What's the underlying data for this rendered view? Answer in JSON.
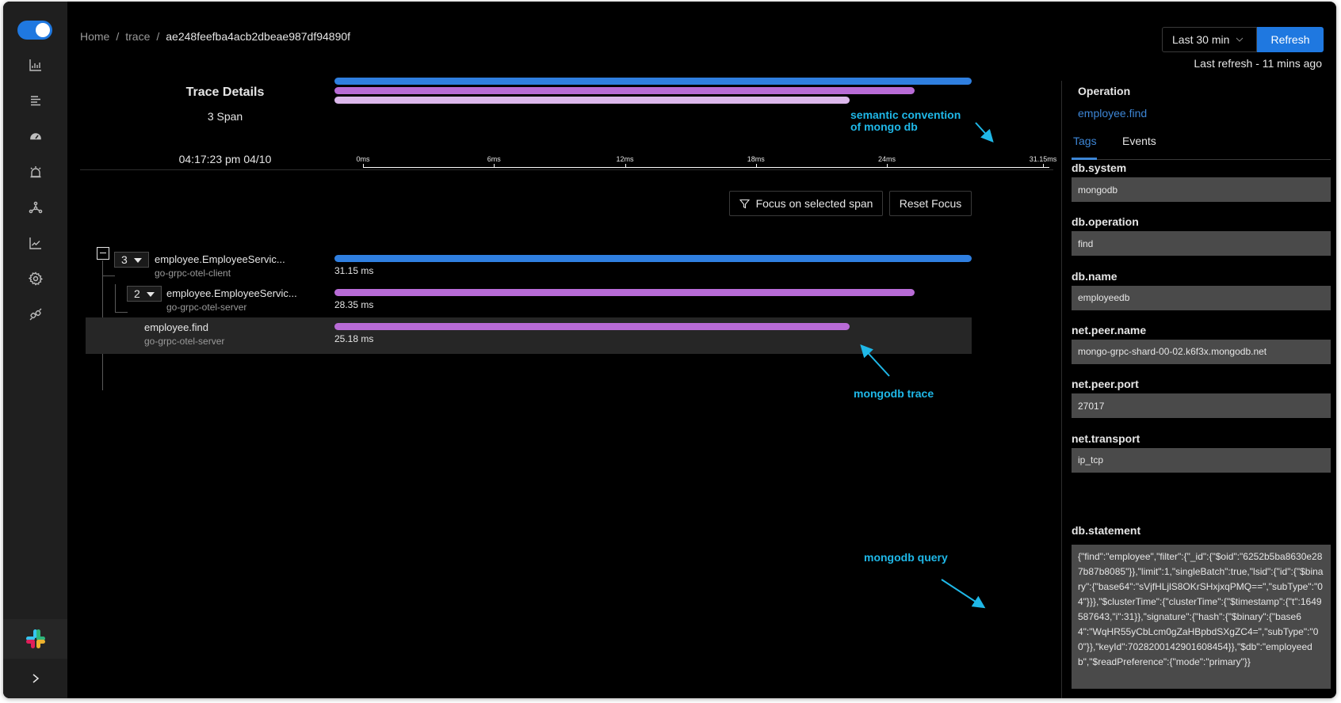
{
  "sidebar": {
    "toggle_on": true,
    "nav_items": [
      {
        "name": "services",
        "icon": "bar-chart-icon"
      },
      {
        "name": "traces",
        "icon": "list-icon"
      },
      {
        "name": "dashboard",
        "icon": "gauge-icon"
      },
      {
        "name": "alerts",
        "icon": "alarm-icon"
      },
      {
        "name": "service-map",
        "icon": "graph-nodes-icon"
      },
      {
        "name": "metrics",
        "icon": "line-chart-icon"
      },
      {
        "name": "settings",
        "icon": "gear-icon"
      },
      {
        "name": "integrations",
        "icon": "plug-icon"
      }
    ],
    "slack_icon": "slack-icon",
    "expand_label": ">"
  },
  "breadcrumb": {
    "home": "Home",
    "sep1": "/",
    "trace": "trace",
    "sep2": "/",
    "trace_id": "ae248feefba4acb2dbeae987df94890f"
  },
  "topbar": {
    "time_range": "Last 30 min",
    "refresh_label": "Refresh",
    "last_refresh": "Last refresh - 11 mins ago",
    "accent": "#1f78e0"
  },
  "trace": {
    "title": "Trace Details",
    "span_count": "3 Span",
    "start_time": "04:17:23 pm 04/10",
    "total_ms": 31.15,
    "axis_ticks": [
      {
        "label": "0ms",
        "value": 0
      },
      {
        "label": "6ms",
        "value": 6
      },
      {
        "label": "12ms",
        "value": 12
      },
      {
        "label": "18ms",
        "value": 18
      },
      {
        "label": "24ms",
        "value": 24
      },
      {
        "label": "31.15ms",
        "value": 31.15
      }
    ],
    "minimap": [
      {
        "duration_ms": 31.15,
        "color": "#2f7fe0"
      },
      {
        "duration_ms": 28.35,
        "color": "#b86bd6"
      },
      {
        "duration_ms": 25.18,
        "color": "#dcb8ec"
      }
    ]
  },
  "actions": {
    "focus_label": "Focus on selected span",
    "reset_label": "Reset Focus"
  },
  "spans": [
    {
      "name": "employee.EmployeeServic...",
      "service": "go-grpc-otel-client",
      "children_count": "3",
      "duration_label": "31.15 ms",
      "duration_ms": 31.15,
      "color": "#2f7fe0",
      "selected": false
    },
    {
      "name": "employee.EmployeeServic...",
      "service": "go-grpc-otel-server",
      "children_count": "2",
      "duration_label": "28.35 ms",
      "duration_ms": 28.35,
      "color": "#b86bd6",
      "selected": false
    },
    {
      "name": "employee.find",
      "service": "go-grpc-otel-server",
      "children_count": "",
      "duration_label": "25.18 ms",
      "duration_ms": 25.18,
      "color": "#b86bd6",
      "selected": true
    }
  ],
  "details": {
    "operation_label": "Operation",
    "operation_value": "employee.find",
    "tabs": [
      {
        "label": "Tags",
        "active": true
      },
      {
        "label": "Events",
        "active": false
      }
    ],
    "tags": [
      {
        "key": "db.system",
        "value": "mongodb"
      },
      {
        "key": "db.operation",
        "value": "find"
      },
      {
        "key": "db.name",
        "value": "employeedb"
      },
      {
        "key": "net.peer.name",
        "value": "mongo-grpc-shard-00-02.k6f3x.mongodb.net"
      },
      {
        "key": "net.peer.port",
        "value": "27017"
      },
      {
        "key": "net.transport",
        "value": "ip_tcp"
      }
    ],
    "statement_key": "db.statement",
    "statement_value": "{\"find\":\"employee\",\"filter\":{\"_id\":{\"$oid\":\"6252b5ba8630e287b87b8085\"}},\"limit\":1,\"singleBatch\":true,\"lsid\":{\"id\":{\"$binary\":{\"base64\":\"sVjfHLjlS8OKrSHxjxqPMQ==\",\"subType\":\"04\"}}},\"$clusterTime\":{\"clusterTime\":{\"$timestamp\":{\"t\":1649587643,\"i\":31}},\"signature\":{\"hash\":{\"$binary\":{\"base64\":\"WqHR55yCbLcm0gZaHBpbdSXgZC4=\",\"subType\":\"00\"}},\"keyId\":7028200142901608454}},\"$db\":\"employeedb\",\"$readPreference\":{\"mode\":\"primary\"}}"
  },
  "annotations": {
    "semantic": "semantic convention of mongo db",
    "semantic_line1": "semantic convention",
    "semantic_line2": "of mongo db",
    "trace": "mongodb trace",
    "query": "mongodb query",
    "color": "#1fb8e8"
  }
}
